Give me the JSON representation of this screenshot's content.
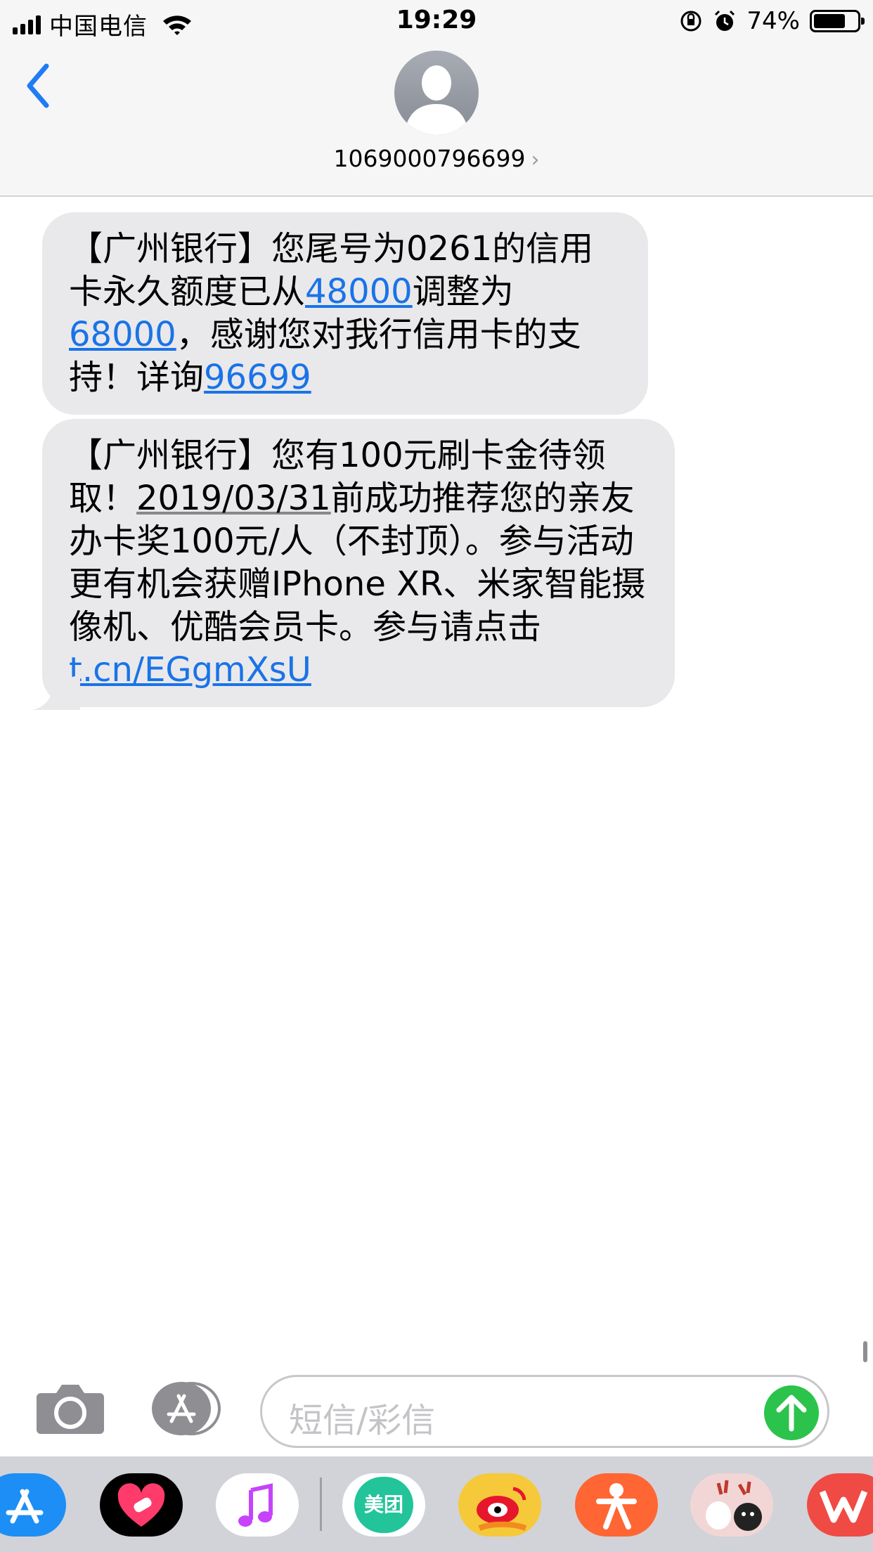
{
  "status_bar": {
    "carrier": "中国电信",
    "time": "19:29",
    "battery_percent": "74%",
    "battery_level": 0.74
  },
  "header": {
    "contact_number": "1069000796699",
    "back_icon": "chevron-left-icon",
    "avatar_icon": "person-silhouette-icon"
  },
  "messages": [
    {
      "segments": [
        {
          "text": "【广州银行】您尾号为0261的信用卡永久额度已从"
        },
        {
          "text": "48000",
          "link": true
        },
        {
          "text": "调整为"
        },
        {
          "text": "68000",
          "link": true
        },
        {
          "text": "，感谢您对我行信用卡的支持！详询"
        },
        {
          "text": "96699",
          "link": true
        }
      ]
    },
    {
      "segments": [
        {
          "text": "【广州银行】您有100元刷卡金待领取！"
        },
        {
          "text": "2019/03/31",
          "underline": true
        },
        {
          "text": "前成功推荐您的亲友办卡奖100元/人（不封顶）。参与活动更有机会获赠IPhone XR、米家智能摄像机、优酷会员卡。参与请点击 "
        },
        {
          "text": "t.cn/EGgmXsU",
          "link": true
        }
      ]
    }
  ],
  "composer": {
    "placeholder": "短信/彩信",
    "camera_icon": "camera-icon",
    "apps_icon": "app-store-icon",
    "send_icon": "send-arrow-icon"
  },
  "app_drawer": {
    "apps": [
      "App Store",
      "Digital Touch",
      "Music",
      "美团",
      "Weibo",
      "Dianping",
      "Sticker",
      "WPS"
    ],
    "meituan_label": "美团"
  },
  "colors": {
    "bubble": "#e9e9eb",
    "link": "#1a73e8",
    "ios_blue": "#1f7cf4",
    "send_green": "#2bc34b"
  }
}
